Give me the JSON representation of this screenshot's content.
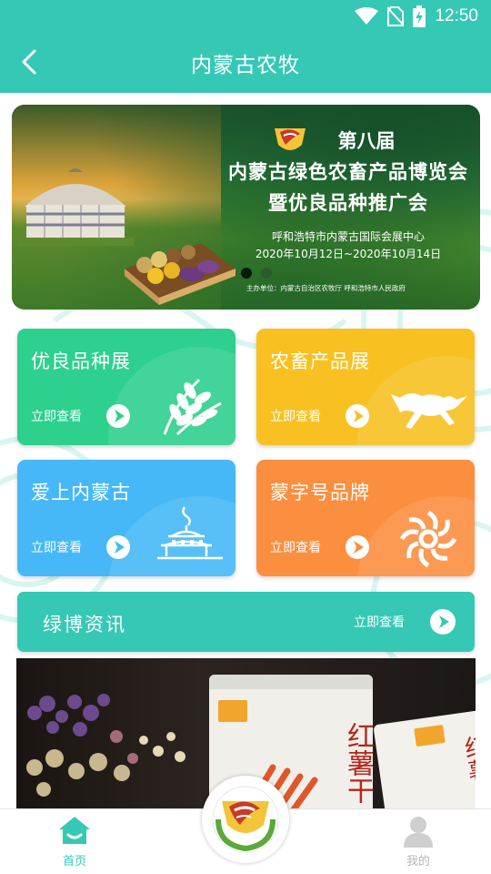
{
  "status_bar": {
    "time": "12:50"
  },
  "app_bar": {
    "title": "内蒙古农牧"
  },
  "banner": {
    "edition": "第八届",
    "title_line1": "内蒙古绿色农畜产品博览会",
    "title_line2": "暨优良品种推广会",
    "venue": "呼和浩特市内蒙古国际会展中心",
    "dates": "2020年10月12日~2020年10月14日",
    "sponsor": "主办单位：内蒙古自治区农牧厅   呼和浩特市人民政府",
    "slide_count": 2,
    "active_slide": 1
  },
  "cards": [
    {
      "title": "优良品种展",
      "link": "立即查看",
      "icon": "wheat-icon",
      "color": "#2dd08d"
    },
    {
      "title": "农畜产品展",
      "link": "立即查看",
      "icon": "horse-icon",
      "color": "#f8c121"
    },
    {
      "title": "爱上内蒙古",
      "link": "立即查看",
      "icon": "temple-icon",
      "color": "#46b8f7"
    },
    {
      "title": "蒙字号品牌",
      "link": "立即查看",
      "icon": "knot-pattern-icon",
      "color": "#fc8e3f"
    }
  ],
  "news": {
    "title": "绿博资讯",
    "link": "立即查看"
  },
  "product_photo": {
    "bag_text_1": "红薯干",
    "bag_text_2": "红薯"
  },
  "bottom_nav": {
    "home_label": "首页",
    "mine_label": "我的"
  },
  "colors": {
    "primary": "#35c9b5",
    "green_card": "#2dd08d",
    "yellow_card": "#f8c121",
    "blue_card": "#46b8f7",
    "orange_card": "#fc8e3f",
    "inactive_nav": "#b6b6b6"
  }
}
